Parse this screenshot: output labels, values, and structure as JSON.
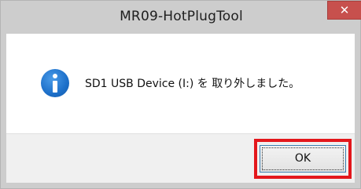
{
  "window": {
    "title": "MR09-HotPlugTool",
    "close_glyph": "✕"
  },
  "dialog": {
    "icon": "info-icon",
    "message": "SD1 USB Device (I:) を 取り外しました。",
    "ok_label": "OK"
  },
  "colors": {
    "titlebar": "#cdcdcd",
    "close_button": "#c7504d",
    "highlight": "#e3171c",
    "footer": "#f0f0f0",
    "info_icon": "#1c6fc9"
  }
}
